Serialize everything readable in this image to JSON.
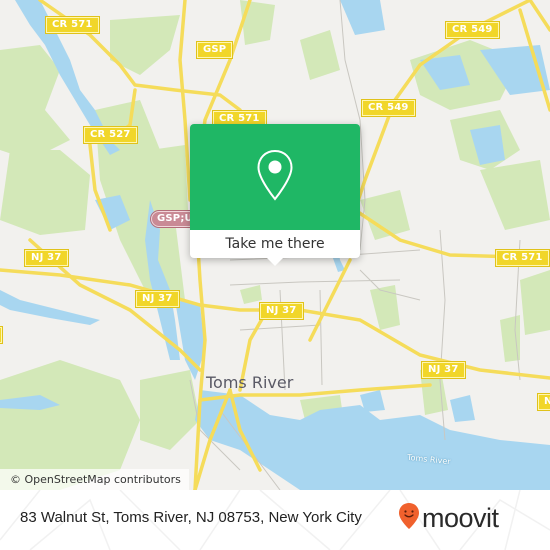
{
  "map": {
    "road_labels": [
      {
        "id": "cr571-nw",
        "text": "CR 571",
        "type": "county"
      },
      {
        "id": "gsp-north",
        "text": "GSP",
        "type": "county"
      },
      {
        "id": "cr549-ne",
        "text": "CR 549",
        "type": "county"
      },
      {
        "id": "cr549-mid",
        "text": "CR 549",
        "type": "county"
      },
      {
        "id": "cr571-mid",
        "text": "CR 571",
        "type": "county"
      },
      {
        "id": "cr527",
        "text": "CR 527",
        "type": "county"
      },
      {
        "id": "gsp-us",
        "text": "GSP;U",
        "type": "interstate"
      },
      {
        "id": "cr571-east",
        "text": "CR 571",
        "type": "county"
      },
      {
        "id": "nj37-west",
        "text": "NJ 37",
        "type": "state"
      },
      {
        "id": "nj37-wmid",
        "text": "NJ 37",
        "type": "state"
      },
      {
        "id": "nj37-center",
        "text": "NJ 37",
        "type": "state"
      },
      {
        "id": "nj37-east",
        "text": "NJ 37",
        "type": "state"
      },
      {
        "id": "nj37-edge",
        "text": "N",
        "type": "state"
      },
      {
        "id": "cr-west-edge",
        "text": "",
        "type": "county"
      }
    ],
    "city_label": "Toms River",
    "water_label": "Toms River",
    "attribution": "© OpenStreetMap contributors",
    "colors": {
      "land": "#f2f1ee",
      "park": "#cfe6b0",
      "water": "#a8d6f0",
      "road": "#f5dc5a",
      "minor_road": "#c8c6c0"
    }
  },
  "popup": {
    "icon": "map-pin-icon",
    "action_label": "Take me there",
    "color": "#1fb765"
  },
  "footer": {
    "address": "83 Walnut St, Toms River, NJ 08753, New York City",
    "brand": "moovit",
    "brand_icon": "moovit-smiley-pin-icon",
    "brand_color": "#f0612d"
  }
}
